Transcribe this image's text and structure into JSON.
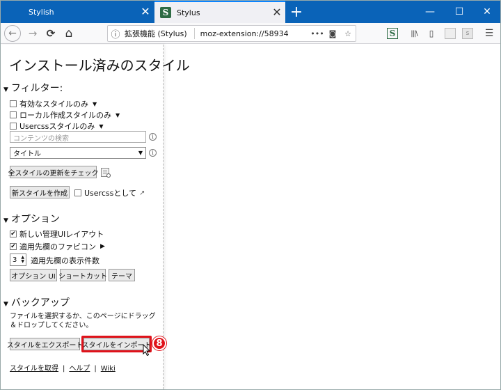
{
  "tabs": [
    {
      "label": "Stylish",
      "close": "✕"
    },
    {
      "label": "Stylus",
      "close": "✕",
      "favicon": "S"
    }
  ],
  "new_tab": "+",
  "window_controls": {
    "minimize": "—",
    "maximize": "☐",
    "close": "✕"
  },
  "nav": {
    "back": "←",
    "forward": "→",
    "reload": "⟳",
    "home": "⌂"
  },
  "urlbar": {
    "identity": "拡張機能 (Stylus)",
    "url": "moz-extension://58934",
    "more": "•••",
    "pocket": "◙",
    "bookmark": "☆"
  },
  "toolbar": {
    "stylus": "S",
    "library": "|||\\",
    "sidebar": "▯",
    "menu": "☰"
  },
  "sidebar": {
    "title": "インストール済みのスタイル",
    "filter": {
      "heading": "フィルター:",
      "items": [
        {
          "label": "有効なスタイルのみ",
          "checked": false
        },
        {
          "label": "ローカル作成スタイルのみ",
          "checked": false
        },
        {
          "label": "Usercssスタイルのみ",
          "checked": false
        }
      ],
      "search_placeholder": "コンテンツの検索",
      "sort_value": "タイトル"
    },
    "check_updates_button": "全スタイルの更新をチェック",
    "new_style_button": "新スタイルを作成",
    "as_usercss_label": "Usercssとして",
    "options": {
      "heading": "オプション",
      "items": [
        {
          "label": "新しい管理UIレイアウト",
          "checked": true
        },
        {
          "label": "適用先欄のファビコン",
          "checked": true
        }
      ],
      "targets_count": "3",
      "targets_label": "適用先欄の表示件数",
      "buttons": [
        "オプション UI",
        "ショートカット",
        "テーマ"
      ]
    },
    "backup": {
      "heading": "バックアップ",
      "description": "ファイルを選択するか、このページにドラッグ＆ドロップしてください。",
      "export_button": "スタイルをエクスポート",
      "import_button": "スタイルをインポート",
      "step_number": "8"
    },
    "footer": {
      "get_styles": "スタイルを取得",
      "help": "ヘルプ",
      "wiki": "Wiki",
      "separator": "|"
    }
  }
}
